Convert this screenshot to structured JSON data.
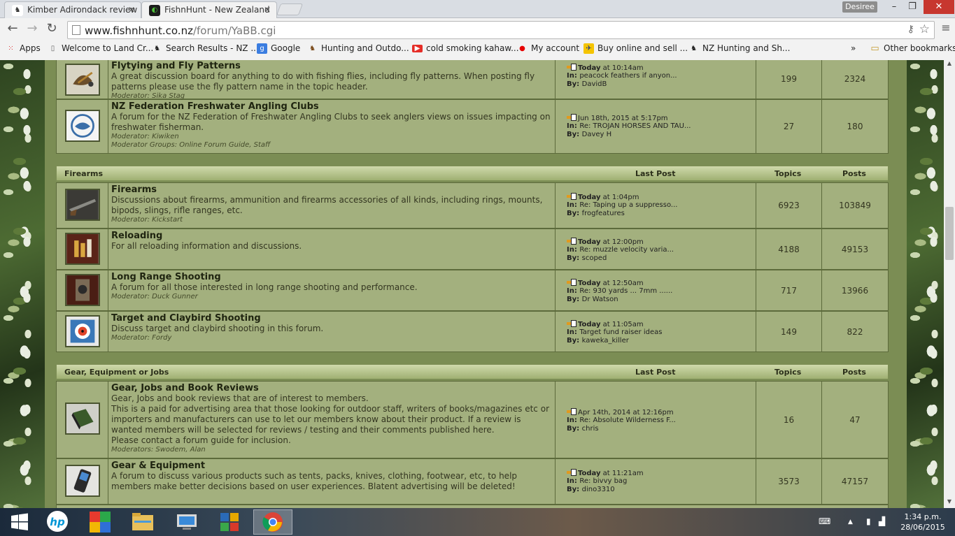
{
  "browser": {
    "tabs": [
      {
        "title": "Kimber Adirondack review",
        "favicon": "deer-icon"
      },
      {
        "title": "FishnHunt - New Zealand",
        "favicon": "fishnhunt-icon",
        "active": true
      }
    ],
    "user": "Desiree",
    "url_host": "www.fishnhunt.co.nz",
    "url_path": "/forum/YaBB.cgi",
    "bookmarks": [
      {
        "label": "Apps",
        "icon": "apps-icon"
      },
      {
        "label": "Welcome to Land Cr...",
        "icon": "page-icon"
      },
      {
        "label": "Search Results - NZ ...",
        "icon": "deer-icon"
      },
      {
        "label": "Google",
        "icon": "google-icon"
      },
      {
        "label": "Hunting and Outdo...",
        "icon": "deer-icon"
      },
      {
        "label": "cold smoking kahaw...",
        "icon": "youtube-icon"
      },
      {
        "label": "My account",
        "icon": "vodafone-icon"
      },
      {
        "label": "Buy online and sell ...",
        "icon": "trademe-icon"
      },
      {
        "label": "NZ Hunting and Sh...",
        "icon": "deer-icon"
      }
    ],
    "bookmarks_overflow": "»",
    "other_bookmarks": "Other bookmarks"
  },
  "categories": [
    {
      "name": "",
      "forums": [
        {
          "title": "Flytying and Fly Patterns",
          "description": "A great discussion board for anything to do with fishing flies, including fly patterns. When posting fly patterns please use the fly pattern name in the topic header.",
          "moderator": "Moderator: Sika Stag",
          "last_post_date": "Today",
          "last_post_time": " at 10:14am",
          "last_post_in": "peacock feathers if anyon...",
          "last_post_by": "DavidB",
          "topics": "199",
          "posts": "2324",
          "icon": "fly-icon"
        },
        {
          "title": "NZ Federation Freshwater Angling Clubs",
          "description": "A forum for the NZ Federation of Freshwater Angling Clubs to seek anglers views on issues impacting on freshwater fisherman.",
          "moderator": "Moderator: Kiwiken",
          "moderator_groups": "Moderator Groups: Online Forum Guide, Staff",
          "last_post_date": "Jun 18th, 2015",
          "last_post_time": " at 5:17pm",
          "last_post_in": "Re: TROJAN HORSES AND TAU...",
          "last_post_by": "Davey H",
          "topics": "27",
          "posts": "180",
          "icon": "angling-club-logo-icon"
        }
      ]
    },
    {
      "name": "Firearms",
      "headers": {
        "last_post": "Last Post",
        "topics": "Topics",
        "posts": "Posts"
      },
      "forums": [
        {
          "title": "Firearms",
          "description": "Discussions about firearms, ammunition and firearms accessories of all kinds, including rings, mounts, bipods, slings, rifle ranges, etc.",
          "moderator": "Moderator: Kickstart",
          "last_post_date": "Today",
          "last_post_time": " at 1:04pm",
          "last_post_in": "Re: Taping up a suppresso...",
          "last_post_by": "frogfeatures",
          "topics": "6923",
          "posts": "103849",
          "icon": "rifle-icon"
        },
        {
          "title": "Reloading",
          "description": "For all reloading information and discussions.",
          "last_post_date": "Today",
          "last_post_time": " at 12:00pm",
          "last_post_in": "Re: muzzle velocity varia...",
          "last_post_by": "scoped",
          "topics": "4188",
          "posts": "49153",
          "icon": "reloading-icon"
        },
        {
          "title": "Long Range Shooting",
          "description": "A forum for all those interested in long range shooting and performance.",
          "moderator": "Moderator: Duck Gunner",
          "last_post_date": "Today",
          "last_post_time": " at 12:50am",
          "last_post_in": "Re: 930 yards ... 7mm ......",
          "last_post_by": "Dr Watson",
          "topics": "717",
          "posts": "13966",
          "icon": "long-range-icon"
        },
        {
          "title": "Target and Claybird Shooting",
          "description": "Discuss target and claybird shooting in this forum.",
          "moderator": "Moderator: Fordy",
          "last_post_date": "Today",
          "last_post_time": " at 11:05am",
          "last_post_in": "Target fund raiser ideas",
          "last_post_by": "kaweka_killer",
          "topics": "149",
          "posts": "822",
          "icon": "target-icon"
        }
      ]
    },
    {
      "name": "Gear, Equipment or Jobs",
      "headers": {
        "last_post": "Last Post",
        "topics": "Topics",
        "posts": "Posts"
      },
      "forums": [
        {
          "title": "Gear, Jobs and Book Reviews",
          "description": "Gear, Jobs and book reviews that are of interest to members.",
          "description2": "This is a paid for advertising area that those looking for outdoor staff, writers of books/magazines etc or importers and manufacturers can use to let our members know about their product. If a review is wanted members will be selected for reviews / testing and their comments published here.",
          "description3": "Please contact a forum guide for inclusion.",
          "moderator": "Moderators: Swodem, Alan",
          "last_post_date": "Apr 14th, 2014",
          "last_post_time": " at 12:16pm",
          "last_post_in": "Re: Absolute Wilderness F...",
          "last_post_by": "chris",
          "topics": "16",
          "posts": "47",
          "icon": "book-icon"
        },
        {
          "title": "Gear & Equipment",
          "description": "A forum to discuss various products such as tents, packs, knives, clothing, footwear, etc, to help members make better decisions based on user experiences. Blatent advertising will be deleted!",
          "last_post_date": "Today",
          "last_post_time": " at 11:21am",
          "last_post_in": "Re: bivvy bag",
          "last_post_by": "dino3310",
          "topics": "3573",
          "posts": "47157",
          "icon": "gps-icon"
        }
      ]
    }
  ],
  "labels": {
    "in": "In: ",
    "by": "By: "
  },
  "taskbar": {
    "time": "1:34 p.m.",
    "date": "28/06/2015",
    "apps": [
      "windows-start-icon",
      "hp-icon",
      "puzzle-app-icon",
      "file-explorer-icon",
      "remote-desktop-icon",
      "store-icon",
      "chrome-icon"
    ]
  }
}
